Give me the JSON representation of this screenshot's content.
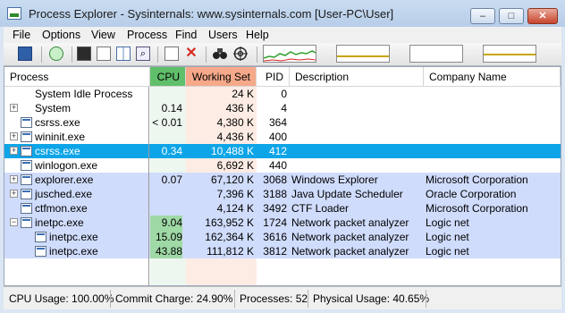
{
  "window": {
    "title": "Process Explorer - Sysinternals: www.sysinternals.com [User-PC\\User]",
    "minimize_glyph": "–",
    "maximize_glyph": "□",
    "close_glyph": "✕"
  },
  "menu": [
    "File",
    "Options",
    "View",
    "Process",
    "Find",
    "Users",
    "Help"
  ],
  "toolbar": {
    "icons": [
      "save-icon",
      "refresh-icon",
      "system-info-icon",
      "properties-icon",
      "columns-icon",
      "find-window-icon",
      "kill-process-icon",
      "find-handle-icon",
      "target-icon"
    ],
    "find_glyph": "⌕",
    "kill_glyph": "✕",
    "graphs": [
      "cpu-usage-graph",
      "commit-graph",
      "io-graph",
      "physical-memory-graph"
    ]
  },
  "columns": {
    "process": "Process",
    "cpu": "CPU",
    "working_set": "Working Set",
    "pid": "PID",
    "description": "Description",
    "company": "Company Name"
  },
  "colors": {
    "cpu_column": "#60bf6a",
    "working_set_column": "#f6a98a",
    "selected_row": "#0ea5e8",
    "services_row": "#d0dcfc",
    "own_process_row": "#fbf3a6"
  },
  "processes": [
    {
      "name": "System Idle Process",
      "cpu": "",
      "working_set": "24 K",
      "pid": "0",
      "description": "",
      "company": "",
      "indent": 0,
      "expander": "",
      "style": "plain"
    },
    {
      "name": "System",
      "cpu": "0.14",
      "working_set": "436 K",
      "pid": "4",
      "description": "",
      "company": "",
      "indent": 0,
      "expander": "+",
      "style": "plain"
    },
    {
      "name": "csrss.exe",
      "cpu": "< 0.01",
      "working_set": "4,380 K",
      "pid": "364",
      "description": "",
      "company": "",
      "indent": 0,
      "expander": "",
      "style": "plain"
    },
    {
      "name": "wininit.exe",
      "cpu": "",
      "working_set": "4,436 K",
      "pid": "400",
      "description": "",
      "company": "",
      "indent": 0,
      "expander": "+",
      "style": "plain"
    },
    {
      "name": "csrss.exe",
      "cpu": "0.34",
      "working_set": "10,488 K",
      "pid": "412",
      "description": "",
      "company": "",
      "indent": 0,
      "expander": "+",
      "style": "selected"
    },
    {
      "name": "winlogon.exe",
      "cpu": "",
      "working_set": "6,692 K",
      "pid": "440",
      "description": "",
      "company": "",
      "indent": 0,
      "expander": "",
      "style": "plain"
    },
    {
      "name": "explorer.exe",
      "cpu": "0.07",
      "working_set": "67,120 K",
      "pid": "3068",
      "description": "Windows Explorer",
      "company": "Microsoft Corporation",
      "indent": 0,
      "expander": "+",
      "style": "blue"
    },
    {
      "name": "jusched.exe",
      "cpu": "",
      "working_set": "7,396 K",
      "pid": "3188",
      "description": "Java Update Scheduler",
      "company": "Oracle Corporation",
      "indent": 0,
      "expander": "+",
      "style": "blue"
    },
    {
      "name": "ctfmon.exe",
      "cpu": "",
      "working_set": "4,124 K",
      "pid": "3492",
      "description": "CTF Loader",
      "company": "Microsoft Corporation",
      "indent": 0,
      "expander": "",
      "style": "blue"
    },
    {
      "name": "inetpc.exe",
      "cpu": "9.04",
      "working_set": "163,952 K",
      "pid": "1724",
      "description": "Network packet analyzer",
      "company": "Logic net",
      "indent": 0,
      "expander": "−",
      "style": "blue"
    },
    {
      "name": "inetpc.exe",
      "cpu": "15.09",
      "working_set": "162,364 K",
      "pid": "3616",
      "description": "Network packet analyzer",
      "company": "Logic net",
      "indent": 1,
      "expander": "",
      "style": "blue"
    },
    {
      "name": "inetpc.exe",
      "cpu": "43.88",
      "working_set": "111,812 K",
      "pid": "3812",
      "description": "Network packet analyzer",
      "company": "Logic net",
      "indent": 1,
      "expander": "",
      "style": "blue"
    }
  ],
  "status": {
    "cpu": "CPU Usage: 100.00%",
    "commit": "Commit Charge: 24.90%",
    "processes": "Processes: 52",
    "physical": "Physical Usage: 40.65%"
  }
}
